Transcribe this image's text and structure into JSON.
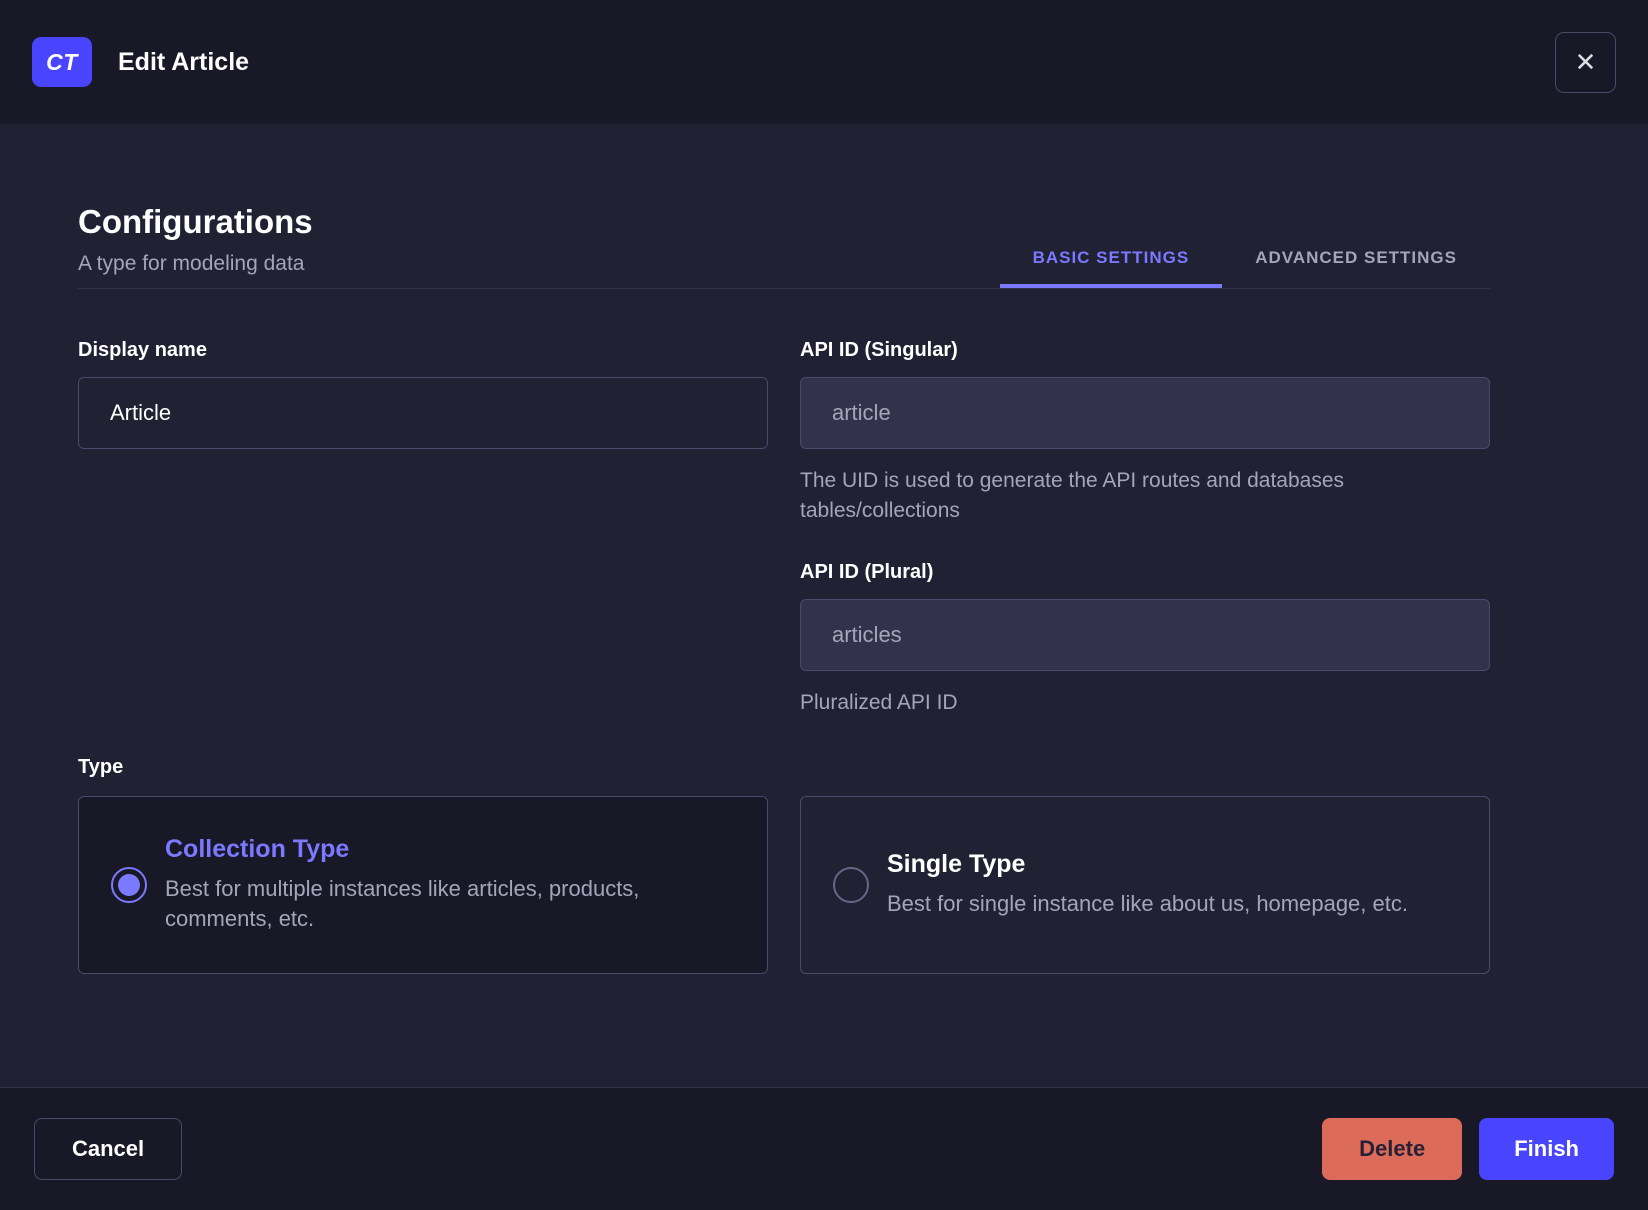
{
  "header": {
    "badge": "CT",
    "title": "Edit Article",
    "close_icon": "✕"
  },
  "main": {
    "title": "Configurations",
    "subtitle": "A type for modeling data",
    "tabs": [
      {
        "label": "BASIC SETTINGS",
        "active": true
      },
      {
        "label": "ADVANCED SETTINGS",
        "active": false
      }
    ],
    "fields": {
      "display_name": {
        "label": "Display name",
        "value": "Article"
      },
      "api_id_singular": {
        "label": "API ID (Singular)",
        "placeholder": "article",
        "hint": "The UID is used to generate the API routes and databases tables/collections"
      },
      "api_id_plural": {
        "label": "API ID (Plural)",
        "placeholder": "articles",
        "hint": "Pluralized API ID"
      }
    },
    "type_section": {
      "label": "Type",
      "options": [
        {
          "title": "Collection Type",
          "description": "Best for multiple instances like articles, products, comments, etc.",
          "selected": true
        },
        {
          "title": "Single Type",
          "description": "Best for single instance like about us, homepage, etc.",
          "selected": false
        }
      ]
    }
  },
  "footer": {
    "cancel_label": "Cancel",
    "delete_label": "Delete",
    "finish_label": "Finish"
  },
  "colors": {
    "primary": "#4945ff",
    "primary_light": "#7b79ff",
    "danger": "#dd6b5a",
    "bg_dark": "#181826",
    "bg_body": "#212134",
    "border": "#4a4a6a",
    "text_muted": "#a5a5ba"
  }
}
